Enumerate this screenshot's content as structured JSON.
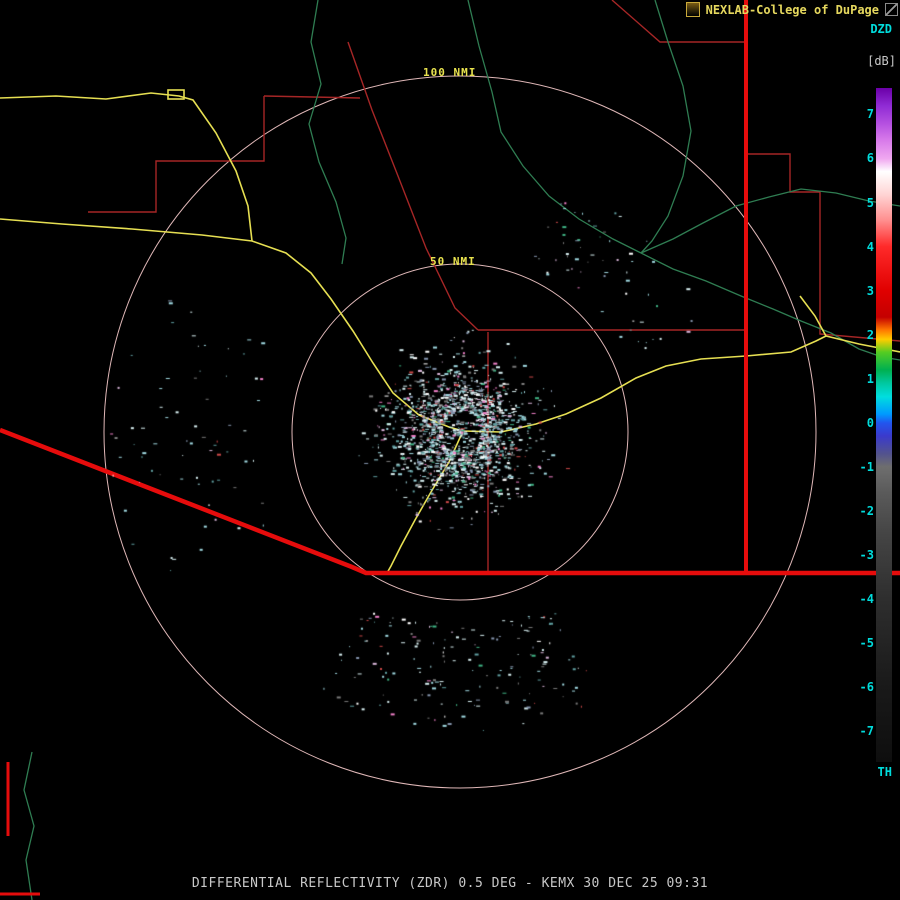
{
  "app": {
    "attribution": "NEXLAB-College of DuPage",
    "caption": "DIFFERENTIAL REFLECTIVITY (ZDR) 0.5 DEG - KEMX 30 DEC 25 09:31"
  },
  "rings": [
    {
      "label": "100 NMI"
    },
    {
      "label": "50 NMI"
    }
  ],
  "colorbar": {
    "product_label": "DZD",
    "units_label": "[dB]",
    "bottom_label": "TH",
    "ticks": [
      "7",
      "6",
      "5",
      "4",
      "3",
      "2",
      "1",
      "0",
      "-1",
      "-2",
      "-3",
      "-4",
      "-5",
      "-6",
      "-7"
    ],
    "value_range": [
      7.6,
      -7.7
    ],
    "gradient": [
      {
        "pos": 0.0,
        "color": "#6b00a8"
      },
      {
        "pos": 0.026,
        "color": "#8f2bd4"
      },
      {
        "pos": 0.052,
        "color": "#b44fe0"
      },
      {
        "pos": 0.078,
        "color": "#d87bea"
      },
      {
        "pos": 0.105,
        "color": "#f0a8f0"
      },
      {
        "pos": 0.124,
        "color": "#ffffff"
      },
      {
        "pos": 0.157,
        "color": "#ffd6d6"
      },
      {
        "pos": 0.196,
        "color": "#ff8f8f"
      },
      {
        "pos": 0.235,
        "color": "#ff2a2a"
      },
      {
        "pos": 0.301,
        "color": "#e00000"
      },
      {
        "pos": 0.34,
        "color": "#c40000"
      },
      {
        "pos": 0.359,
        "color": "#ff7700"
      },
      {
        "pos": 0.373,
        "color": "#ffcc00"
      },
      {
        "pos": 0.392,
        "color": "#55cc22"
      },
      {
        "pos": 0.418,
        "color": "#00b050"
      },
      {
        "pos": 0.438,
        "color": "#00c8a0"
      },
      {
        "pos": 0.458,
        "color": "#00dede"
      },
      {
        "pos": 0.484,
        "color": "#0099ff"
      },
      {
        "pos": 0.497,
        "color": "#2255ee"
      },
      {
        "pos": 0.516,
        "color": "#3a3acc"
      },
      {
        "pos": 0.542,
        "color": "#52528f"
      },
      {
        "pos": 0.562,
        "color": "#6e6e6e"
      },
      {
        "pos": 0.601,
        "color": "#5a5a5a"
      },
      {
        "pos": 0.66,
        "color": "#454545"
      },
      {
        "pos": 0.758,
        "color": "#2e2e2e"
      },
      {
        "pos": 0.889,
        "color": "#191919"
      },
      {
        "pos": 1.0,
        "color": "#0e0e0e"
      }
    ]
  },
  "colors": {
    "background": "#000000",
    "ring": "#e0b8b8",
    "highway": "#e6df52",
    "river": "#2f7d52",
    "county": "#a62626",
    "state_border": "#e60c0c",
    "label_yellow": "#e8e24e",
    "tick_cyan": "#00dcdc",
    "caption_gray": "#c8c8c8"
  }
}
